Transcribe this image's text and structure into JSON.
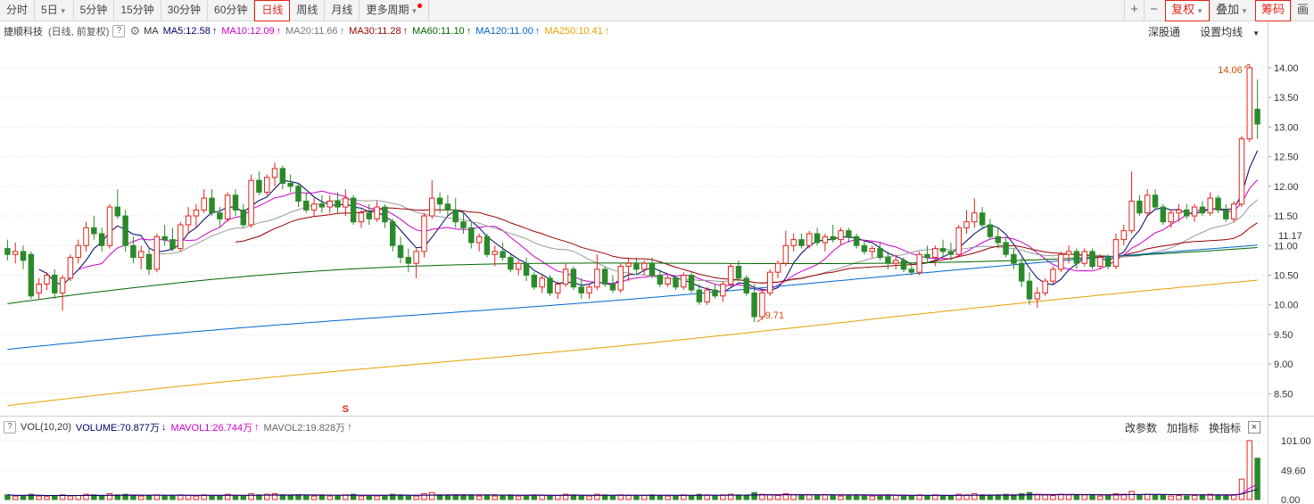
{
  "toolbar": {
    "tabs": [
      {
        "label": "分时",
        "active": false,
        "dropdown": false
      },
      {
        "label": "5日",
        "active": false,
        "dropdown": true
      },
      {
        "label": "5分钟",
        "active": false,
        "dropdown": false
      },
      {
        "label": "15分钟",
        "active": false,
        "dropdown": false
      },
      {
        "label": "30分钟",
        "active": false,
        "dropdown": false
      },
      {
        "label": "60分钟",
        "active": false,
        "dropdown": false
      },
      {
        "label": "日线",
        "active": true,
        "dropdown": false
      },
      {
        "label": "周线",
        "active": false,
        "dropdown": false
      },
      {
        "label": "月线",
        "active": false,
        "dropdown": false
      },
      {
        "label": "更多周期",
        "active": false,
        "dropdown": true
      }
    ],
    "zoom_in": "+",
    "zoom_out": "−",
    "fuquan": "复权",
    "overlay": "叠加",
    "chips": "筹码",
    "draw": "画"
  },
  "price_legend": {
    "stock": "捷顺科技",
    "mode": "(日线, 前复权)",
    "help": "?",
    "ma_label": "MA",
    "mas": [
      {
        "text": "MA5:12.58",
        "arrow": "↑",
        "color": "#000066"
      },
      {
        "text": "MA10:12.09",
        "arrow": "↑",
        "color": "#cc00cc"
      },
      {
        "text": "MA20:11.66",
        "arrow": "↑",
        "color": "#777777"
      },
      {
        "text": "MA30:11.28",
        "arrow": "↑",
        "color": "#990000"
      },
      {
        "text": "MA60:11.10",
        "arrow": "↑",
        "color": "#006600"
      },
      {
        "text": "MA120:11.00",
        "arrow": "↑",
        "color": "#0066cc"
      },
      {
        "text": "MA250:10.41",
        "arrow": "↑",
        "color": "#e6a000"
      }
    ],
    "right": [
      "深股通",
      "设置均线"
    ]
  },
  "price_axis": {
    "ticks": [
      "14.00",
      "13.50",
      "13.00",
      "12.50",
      "12.00",
      "11.50",
      "11.00",
      "10.50",
      "10.00",
      "9.50",
      "9.00",
      "8.50"
    ],
    "current": "11.17",
    "max_label": "14.06",
    "min_label": "9.71",
    "event_marker": "S"
  },
  "vol_legend": {
    "help": "?",
    "name": "VOL(10,20)",
    "volume": "VOLUME:70.877万",
    "volume_arrow": "↓",
    "mavol1": "MAVOL1:26.744万",
    "mavol1_arrow": "↑",
    "mavol2": "MAVOL2:19.828万",
    "mavol2_arrow": "↑",
    "right": [
      "改参数",
      "加指标",
      "换指标"
    ],
    "close": "×"
  },
  "vol_axis": {
    "ticks": [
      "101.00",
      "49.60",
      "0.00"
    ]
  },
  "colors": {
    "up": "#e2231a",
    "down": "#2a8a2a",
    "up_fill": "#ffffff"
  },
  "chart_data": {
    "type": "candlestick",
    "price_ylim": [
      8.25,
      14.3
    ],
    "volume_ylim": [
      0,
      101
    ],
    "candles": [
      [
        10.95,
        11.1,
        10.75,
        10.85
      ],
      [
        10.85,
        11.05,
        10.7,
        10.9
      ],
      [
        10.9,
        11.0,
        10.6,
        10.75
      ],
      [
        10.85,
        10.9,
        10.1,
        10.15
      ],
      [
        10.2,
        10.45,
        10.1,
        10.35
      ],
      [
        10.35,
        10.55,
        10.25,
        10.5
      ],
      [
        10.5,
        10.6,
        10.1,
        10.2
      ],
      [
        10.2,
        10.5,
        9.9,
        10.45
      ],
      [
        10.45,
        10.85,
        10.4,
        10.8
      ],
      [
        10.8,
        11.1,
        10.7,
        11.0
      ],
      [
        11.0,
        11.4,
        10.9,
        11.3
      ],
      [
        11.3,
        11.5,
        11.1,
        11.2
      ],
      [
        11.2,
        11.3,
        10.9,
        11.0
      ],
      [
        11.0,
        11.7,
        10.95,
        11.65
      ],
      [
        11.65,
        11.95,
        11.45,
        11.5
      ],
      [
        11.5,
        11.6,
        10.9,
        11.0
      ],
      [
        11.0,
        11.15,
        10.7,
        10.8
      ],
      [
        10.8,
        11.0,
        10.6,
        10.9
      ],
      [
        10.85,
        10.95,
        10.5,
        10.6
      ],
      [
        10.6,
        11.2,
        10.55,
        11.15
      ],
      [
        11.15,
        11.35,
        11.0,
        11.1
      ],
      [
        11.1,
        11.3,
        10.9,
        10.95
      ],
      [
        10.95,
        11.4,
        10.9,
        11.35
      ],
      [
        11.35,
        11.65,
        11.2,
        11.5
      ],
      [
        11.5,
        11.7,
        11.3,
        11.6
      ],
      [
        11.6,
        11.95,
        11.55,
        11.8
      ],
      [
        11.8,
        11.95,
        11.5,
        11.55
      ],
      [
        11.55,
        11.65,
        11.3,
        11.45
      ],
      [
        11.45,
        11.9,
        11.4,
        11.85
      ],
      [
        11.85,
        11.95,
        11.5,
        11.6
      ],
      [
        11.6,
        11.7,
        11.3,
        11.35
      ],
      [
        11.35,
        12.2,
        11.3,
        12.1
      ],
      [
        12.1,
        12.25,
        11.85,
        11.9
      ],
      [
        11.9,
        12.2,
        11.85,
        12.15
      ],
      [
        12.15,
        12.4,
        12.0,
        12.3
      ],
      [
        12.3,
        12.35,
        11.95,
        12.05
      ],
      [
        12.05,
        12.2,
        11.9,
        12.0
      ],
      [
        12.0,
        12.05,
        11.65,
        11.75
      ],
      [
        11.75,
        11.9,
        11.55,
        11.6
      ],
      [
        11.6,
        11.8,
        11.5,
        11.7
      ],
      [
        11.7,
        11.85,
        11.55,
        11.65
      ],
      [
        11.65,
        11.85,
        11.55,
        11.75
      ],
      [
        11.75,
        11.9,
        11.55,
        11.65
      ],
      [
        11.65,
        11.95,
        11.5,
        11.8
      ],
      [
        11.8,
        11.85,
        11.35,
        11.4
      ],
      [
        11.4,
        11.6,
        11.3,
        11.55
      ],
      [
        11.55,
        11.7,
        11.35,
        11.45
      ],
      [
        11.45,
        11.75,
        11.4,
        11.65
      ],
      [
        11.65,
        11.7,
        11.3,
        11.4
      ],
      [
        11.4,
        11.45,
        10.9,
        11.0
      ],
      [
        11.0,
        11.15,
        10.7,
        10.8
      ],
      [
        10.8,
        10.95,
        10.55,
        10.7
      ],
      [
        10.7,
        10.95,
        10.45,
        10.9
      ],
      [
        10.9,
        11.55,
        10.8,
        11.5
      ],
      [
        11.5,
        12.1,
        11.45,
        11.8
      ],
      [
        11.8,
        11.9,
        11.55,
        11.7
      ],
      [
        11.7,
        11.85,
        11.5,
        11.6
      ],
      [
        11.6,
        11.8,
        11.3,
        11.4
      ],
      [
        11.4,
        11.55,
        11.2,
        11.3
      ],
      [
        11.3,
        11.4,
        10.95,
        11.05
      ],
      [
        11.05,
        11.2,
        10.9,
        11.15
      ],
      [
        11.15,
        11.2,
        10.8,
        10.85
      ],
      [
        10.85,
        11.0,
        10.65,
        10.9
      ],
      [
        10.9,
        11.05,
        10.75,
        10.8
      ],
      [
        10.8,
        10.85,
        10.55,
        10.6
      ],
      [
        10.6,
        10.75,
        10.5,
        10.7
      ],
      [
        10.7,
        10.8,
        10.4,
        10.5
      ],
      [
        10.5,
        10.55,
        10.25,
        10.3
      ],
      [
        10.3,
        10.5,
        10.2,
        10.45
      ],
      [
        10.45,
        10.5,
        10.15,
        10.2
      ],
      [
        10.2,
        10.4,
        10.1,
        10.35
      ],
      [
        10.35,
        10.7,
        10.3,
        10.6
      ],
      [
        10.6,
        10.65,
        10.25,
        10.3
      ],
      [
        10.3,
        10.45,
        10.1,
        10.2
      ],
      [
        10.2,
        10.35,
        10.1,
        10.3
      ],
      [
        10.3,
        10.85,
        10.25,
        10.6
      ],
      [
        10.6,
        10.65,
        10.3,
        10.35
      ],
      [
        10.35,
        10.5,
        10.2,
        10.25
      ],
      [
        10.25,
        10.7,
        10.2,
        10.65
      ],
      [
        10.65,
        10.8,
        10.4,
        10.7
      ],
      [
        10.7,
        10.8,
        10.5,
        10.6
      ],
      [
        10.6,
        10.75,
        10.5,
        10.7
      ],
      [
        10.7,
        10.8,
        10.45,
        10.5
      ],
      [
        10.5,
        10.6,
        10.3,
        10.35
      ],
      [
        10.35,
        10.5,
        10.3,
        10.45
      ],
      [
        10.45,
        10.5,
        10.25,
        10.3
      ],
      [
        10.3,
        10.55,
        10.25,
        10.5
      ],
      [
        10.5,
        10.55,
        10.2,
        10.25
      ],
      [
        10.25,
        10.35,
        10.0,
        10.05
      ],
      [
        10.05,
        10.3,
        10.0,
        10.25
      ],
      [
        10.25,
        10.35,
        10.1,
        10.15
      ],
      [
        10.15,
        10.4,
        10.05,
        10.35
      ],
      [
        10.35,
        10.7,
        10.3,
        10.65
      ],
      [
        10.65,
        10.75,
        10.4,
        10.45
      ],
      [
        10.45,
        10.5,
        10.15,
        10.2
      ],
      [
        10.2,
        10.35,
        9.71,
        9.8
      ],
      [
        9.8,
        10.25,
        9.75,
        10.2
      ],
      [
        10.2,
        10.6,
        10.15,
        10.55
      ],
      [
        10.55,
        10.75,
        10.45,
        10.7
      ],
      [
        10.7,
        11.25,
        10.65,
        11.0
      ],
      [
        11.0,
        11.2,
        10.9,
        11.1
      ],
      [
        11.1,
        11.2,
        10.95,
        11.0
      ],
      [
        11.0,
        11.25,
        10.95,
        11.2
      ],
      [
        11.2,
        11.3,
        11.0,
        11.05
      ],
      [
        11.05,
        11.2,
        10.9,
        11.15
      ],
      [
        11.15,
        11.35,
        11.05,
        11.1
      ],
      [
        11.1,
        11.3,
        11.0,
        11.25
      ],
      [
        11.25,
        11.3,
        11.05,
        11.15
      ],
      [
        11.15,
        11.2,
        10.95,
        11.0
      ],
      [
        11.0,
        11.1,
        10.85,
        10.9
      ],
      [
        10.9,
        11.0,
        10.8,
        10.95
      ],
      [
        10.95,
        11.05,
        10.75,
        10.8
      ],
      [
        10.8,
        10.9,
        10.6,
        10.7
      ],
      [
        10.7,
        10.85,
        10.6,
        10.75
      ],
      [
        10.75,
        10.8,
        10.55,
        10.6
      ],
      [
        10.6,
        10.7,
        10.5,
        10.55
      ],
      [
        10.55,
        10.9,
        10.5,
        10.85
      ],
      [
        10.85,
        11.0,
        10.7,
        10.8
      ],
      [
        10.8,
        11.0,
        10.65,
        10.95
      ],
      [
        10.95,
        11.1,
        10.8,
        10.9
      ],
      [
        10.9,
        11.05,
        10.75,
        10.85
      ],
      [
        10.85,
        11.35,
        10.8,
        11.3
      ],
      [
        11.3,
        11.6,
        11.2,
        11.4
      ],
      [
        11.4,
        11.8,
        11.3,
        11.55
      ],
      [
        11.55,
        11.65,
        11.3,
        11.35
      ],
      [
        11.35,
        11.45,
        11.1,
        11.15
      ],
      [
        11.15,
        11.3,
        10.95,
        11.05
      ],
      [
        11.05,
        11.15,
        10.8,
        10.85
      ],
      [
        10.85,
        10.95,
        10.6,
        10.7
      ],
      [
        10.7,
        10.8,
        10.3,
        10.4
      ],
      [
        10.4,
        10.55,
        10.0,
        10.1
      ],
      [
        10.1,
        10.3,
        9.95,
        10.2
      ],
      [
        10.2,
        10.45,
        10.15,
        10.4
      ],
      [
        10.4,
        10.65,
        10.35,
        10.6
      ],
      [
        10.6,
        10.9,
        10.55,
        10.85
      ],
      [
        10.85,
        11.0,
        10.7,
        10.9
      ],
      [
        10.9,
        10.95,
        10.6,
        10.7
      ],
      [
        10.7,
        10.95,
        10.65,
        10.9
      ],
      [
        10.9,
        10.95,
        10.6,
        10.65
      ],
      [
        10.65,
        10.85,
        10.6,
        10.8
      ],
      [
        10.8,
        10.85,
        10.6,
        10.65
      ],
      [
        10.65,
        11.2,
        10.6,
        11.1
      ],
      [
        11.1,
        11.35,
        11.0,
        11.25
      ],
      [
        11.25,
        12.25,
        11.2,
        11.75
      ],
      [
        11.75,
        11.85,
        11.5,
        11.55
      ],
      [
        11.55,
        11.95,
        11.5,
        11.85
      ],
      [
        11.85,
        11.95,
        11.6,
        11.65
      ],
      [
        11.65,
        11.7,
        11.35,
        11.4
      ],
      [
        11.4,
        11.6,
        11.3,
        11.55
      ],
      [
        11.55,
        11.7,
        11.4,
        11.6
      ],
      [
        11.6,
        11.7,
        11.45,
        11.5
      ],
      [
        11.5,
        11.7,
        11.4,
        11.65
      ],
      [
        11.65,
        11.75,
        11.5,
        11.55
      ],
      [
        11.55,
        11.9,
        11.5,
        11.8
      ],
      [
        11.8,
        11.85,
        11.55,
        11.6
      ],
      [
        11.6,
        11.7,
        11.4,
        11.45
      ],
      [
        11.45,
        11.75,
        11.4,
        11.7
      ],
      [
        11.7,
        12.85,
        11.65,
        12.8
      ],
      [
        12.8,
        14.06,
        12.75,
        14.0
      ],
      [
        13.3,
        13.8,
        12.8,
        13.05
      ]
    ],
    "volumes": [
      8,
      6,
      7,
      9,
      6,
      5,
      7,
      8,
      6,
      7,
      9,
      8,
      6,
      10,
      8,
      9,
      7,
      6,
      7,
      8,
      6,
      7,
      8,
      7,
      6,
      8,
      7,
      6,
      9,
      7,
      6,
      10,
      8,
      9,
      10,
      8,
      7,
      8,
      7,
      6,
      7,
      6,
      7,
      8,
      9,
      6,
      7,
      6,
      7,
      9,
      8,
      7,
      6,
      10,
      12,
      8,
      7,
      8,
      7,
      8,
      6,
      7,
      6,
      7,
      8,
      6,
      7,
      8,
      7,
      6,
      7,
      9,
      8,
      7,
      6,
      9,
      8,
      7,
      8,
      7,
      6,
      7,
      8,
      7,
      6,
      7,
      8,
      7,
      9,
      8,
      7,
      8,
      9,
      8,
      7,
      12,
      9,
      8,
      7,
      10,
      8,
      7,
      8,
      7,
      8,
      7,
      6,
      7,
      8,
      7,
      6,
      7,
      8,
      7,
      6,
      7,
      8,
      7,
      8,
      7,
      6,
      9,
      8,
      10,
      8,
      7,
      8,
      9,
      8,
      10,
      12,
      9,
      8,
      7,
      9,
      8,
      7,
      8,
      7,
      6,
      7,
      10,
      9,
      14,
      8,
      9,
      8,
      7,
      6,
      7,
      6,
      7,
      8,
      9,
      8,
      7,
      8,
      35,
      101,
      70.9
    ],
    "ma_series": [
      {
        "name": "MA5",
        "period": 5,
        "color": "#000066"
      },
      {
        "name": "MA10",
        "period": 10,
        "color": "#cc00cc"
      },
      {
        "name": "MA20",
        "period": 20,
        "color": "#999999"
      },
      {
        "name": "MA30",
        "period": 30,
        "color": "#990000"
      },
      {
        "name": "MA60",
        "start": 10.02,
        "end": 11.1,
        "color": "#006600"
      },
      {
        "name": "MA120",
        "start": 9.25,
        "end": 11.0,
        "color": "#0066cc"
      },
      {
        "name": "MA250",
        "start": 8.3,
        "end": 10.41,
        "color": "#e6a000"
      }
    ],
    "mavol_series": [
      {
        "name": "MAVOL1",
        "color": "#cc00cc"
      },
      {
        "name": "MAVOL2",
        "color": "#000066"
      }
    ]
  }
}
